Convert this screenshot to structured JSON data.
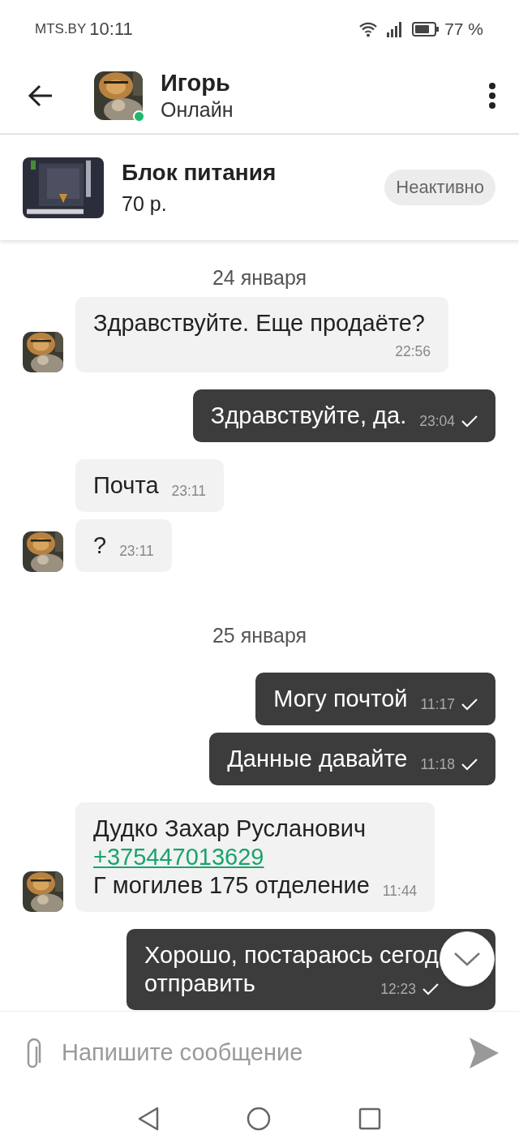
{
  "status_bar": {
    "carrier": "MTS.BY",
    "time": "10:11",
    "battery": "77 %"
  },
  "header": {
    "name": "Игорь",
    "status": "Онлайн",
    "online": true
  },
  "listing": {
    "title": "Блок питания",
    "price": "70 р.",
    "badge": "Неактивно"
  },
  "messages": [
    {
      "kind": "date",
      "text": "24 января"
    },
    {
      "kind": "incoming",
      "avatar": true,
      "lines": [
        {
          "kind": "text",
          "text": "Здравствуйте. Еще продаёте?"
        }
      ],
      "time": "22:56"
    },
    {
      "kind": "outgoing",
      "read": true,
      "lines": [
        {
          "kind": "text",
          "text": "Здравствуйте, да."
        }
      ],
      "time": "23:04"
    },
    {
      "kind": "incoming",
      "avatar": false,
      "lines": [
        {
          "kind": "text",
          "text": "Почта"
        }
      ],
      "time": "23:11"
    },
    {
      "kind": "incoming",
      "avatar": true,
      "lines": [
        {
          "kind": "text",
          "text": "?"
        }
      ],
      "time": "23:11"
    },
    {
      "kind": "date",
      "text": "25 января"
    },
    {
      "kind": "outgoing",
      "read": true,
      "lines": [
        {
          "kind": "text",
          "text": "Могу почтой"
        }
      ],
      "time": "11:17"
    },
    {
      "kind": "outgoing",
      "read": true,
      "lines": [
        {
          "kind": "text",
          "text": "Данные давайте"
        }
      ],
      "time": "11:18"
    },
    {
      "kind": "incoming",
      "avatar": true,
      "lines": [
        {
          "kind": "text",
          "text": "Дудко Захар Русланович"
        },
        {
          "kind": "link",
          "text": "+375447013629"
        },
        {
          "kind": "text",
          "text": "Г могилев 175 отделение"
        }
      ],
      "time": "11:44"
    },
    {
      "kind": "outgoing",
      "read": true,
      "lines": [
        {
          "kind": "text",
          "text": "Хорошо, постараюсь сегод"
        },
        {
          "kind": "text",
          "text": "отправить"
        }
      ],
      "time": "12:23"
    }
  ],
  "composer": {
    "placeholder": "Напишите сообщение"
  }
}
